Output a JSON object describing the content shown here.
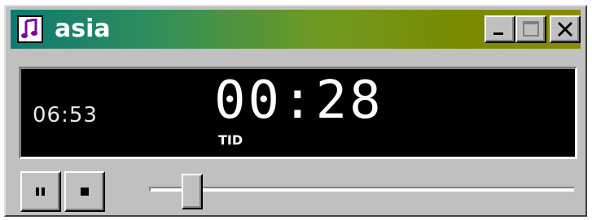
{
  "window": {
    "title": "asia",
    "icon": "music-note-icon",
    "controls": [
      "minimize-icon",
      "maximize-icon",
      "close-icon"
    ],
    "titlebar_colors": [
      "#0e7a74",
      "#8a8a00"
    ]
  },
  "display": {
    "total_time": "06:53",
    "elapsed_time": "00:28",
    "elapsed_label": "TID"
  },
  "controls": {
    "pause_icon": "pause-icon",
    "stop_icon": "stop-icon"
  },
  "seek": {
    "position_fraction": 0.08
  }
}
